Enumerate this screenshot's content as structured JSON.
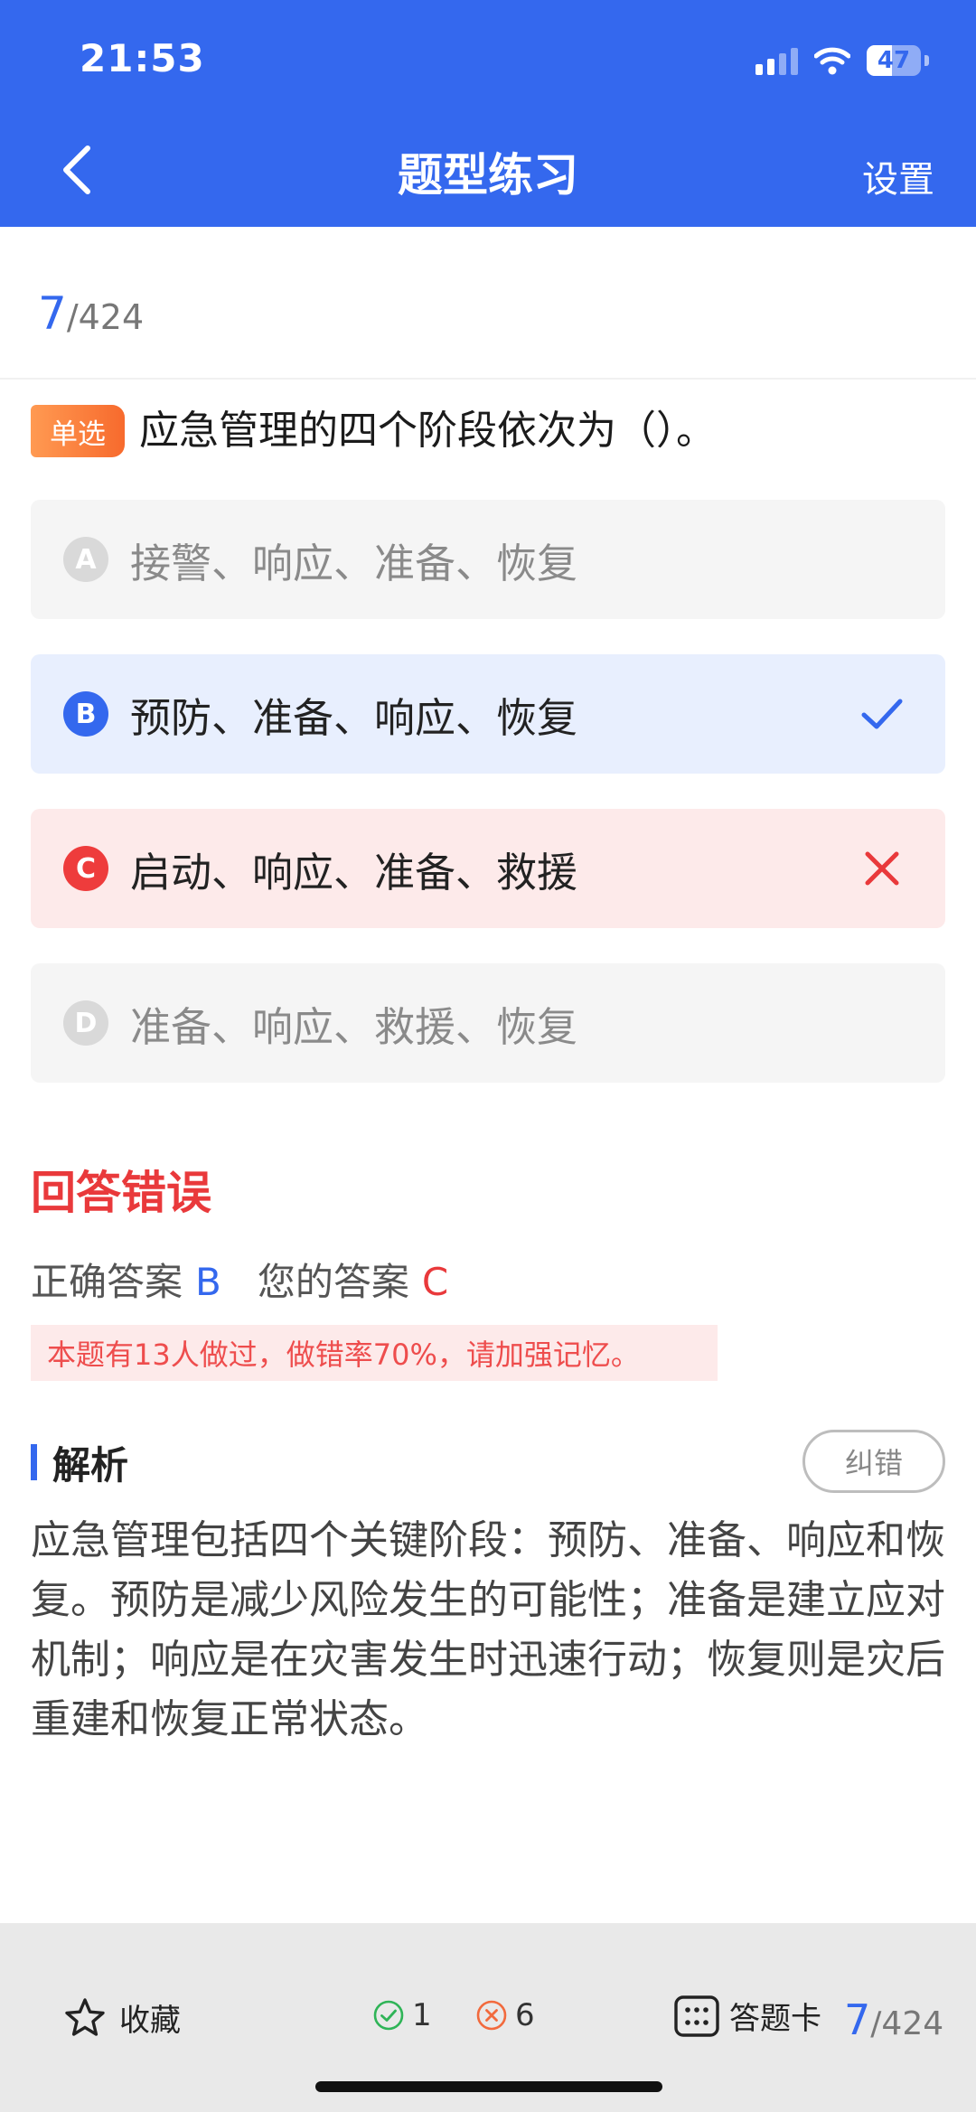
{
  "status_bar": {
    "time": "21:53",
    "battery": "47"
  },
  "header": {
    "title": "题型练习",
    "settings_label": "设置"
  },
  "progress": {
    "current": "7",
    "total": "/424"
  },
  "question": {
    "type": "单选",
    "text": "应急管理的四个阶段依次为（）。",
    "options": [
      {
        "letter": "A",
        "text": "接警、响应、准备、恢复",
        "state": "normal"
      },
      {
        "letter": "B",
        "text": "预防、准备、响应、恢复",
        "state": "correct"
      },
      {
        "letter": "C",
        "text": "启动、响应、准备、救援",
        "state": "wrong"
      },
      {
        "letter": "D",
        "text": "准备、响应、救援、恢复",
        "state": "normal"
      }
    ]
  },
  "result": {
    "title": "回答错误",
    "correct_label": "正确答案",
    "correct_value": "B",
    "your_label": "您的答案",
    "your_value": "C",
    "stats_text": "本题有13人做过，做错率70%，请加强记忆。"
  },
  "analysis": {
    "title": "解析",
    "report_label": "纠错",
    "text": "应急管理包括四个关键阶段：预防、准备、响应和恢复。预防是减少风险发生的可能性；准备是建立应对机制；响应是在灾害发生时迅速行动；恢复则是灾后重建和恢复正常状态。"
  },
  "bottom_bar": {
    "favorite_label": "收藏",
    "right_count": "1",
    "wrong_count": "6",
    "answer_card_label": "答题卡",
    "progress_current": "7",
    "progress_total": "/424"
  },
  "colors": {
    "primary": "#3468ee",
    "error": "#e9393b",
    "tag": "#f76a2d"
  }
}
